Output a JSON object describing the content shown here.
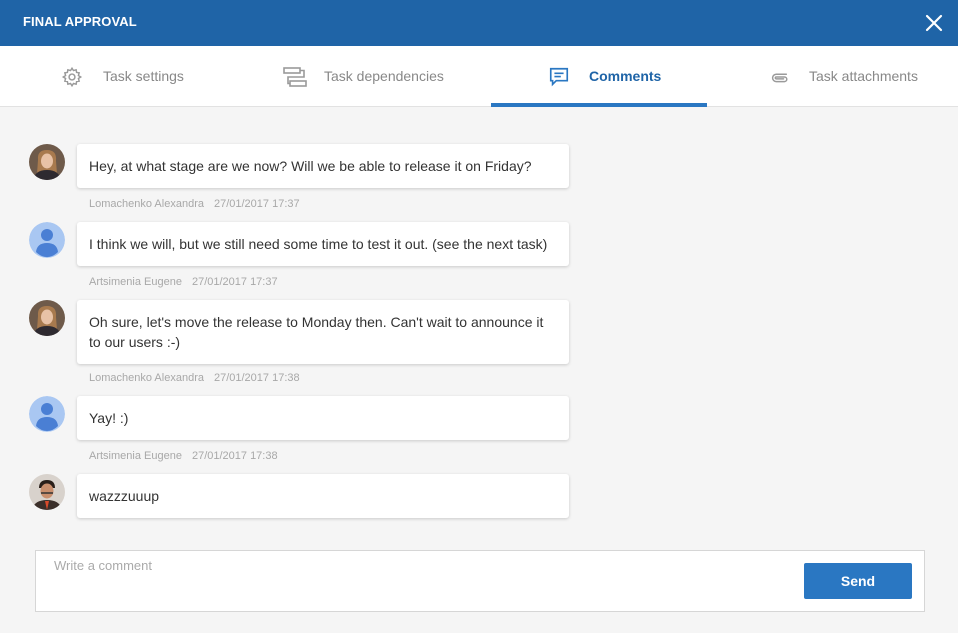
{
  "header": {
    "title": "FINAL APPROVAL",
    "close_icon": "close-icon"
  },
  "tabs": [
    {
      "label": "Task settings",
      "icon": "gear-icon",
      "active": false
    },
    {
      "label": "Task dependencies",
      "icon": "dependencies-icon",
      "active": false
    },
    {
      "label": "Comments",
      "icon": "comment-icon",
      "active": true
    },
    {
      "label": "Task attachments",
      "icon": "paperclip-icon",
      "active": false
    }
  ],
  "comments": [
    {
      "text": "Hey, at what stage are we now? Will we be able to release it on Friday?",
      "author": "Lomachenko Alexandra",
      "date": "27/01/2017 17:37",
      "avatar": "photo-woman"
    },
    {
      "text": "I think we will, but we still need some time to test it out. (see the next task)",
      "author": "Artsimenia Eugene",
      "date": "27/01/2017 17:37",
      "avatar": "default-user"
    },
    {
      "text": "Oh sure, let's move the release to Monday then. Can't wait to announce it to our users :-)",
      "author": "Lomachenko Alexandra",
      "date": "27/01/2017 17:38",
      "avatar": "photo-woman"
    },
    {
      "text": "Yay! :)",
      "author": "Artsimenia Eugene",
      "date": "27/01/2017 17:38",
      "avatar": "default-user"
    },
    {
      "text": "wazzzuuup",
      "author": "",
      "date": "",
      "avatar": "photo-man"
    }
  ],
  "composer": {
    "placeholder": "Write a comment",
    "value": "",
    "send_label": "Send"
  },
  "colors": {
    "header": "#1f64a7",
    "accent": "#2a77c2",
    "background": "#f5f5f5"
  }
}
